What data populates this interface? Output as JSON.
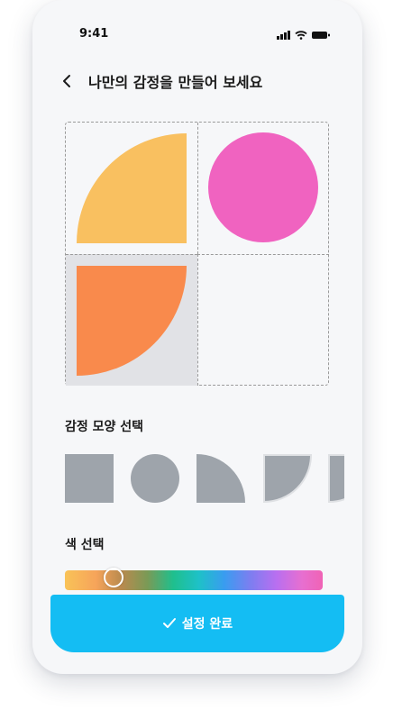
{
  "status": {
    "time": "9:41"
  },
  "header": {
    "title": "나만의 감정을 만들어 보세요",
    "back_icon": "chevron-left-icon"
  },
  "shape_section": {
    "label": "감정 모양 선택"
  },
  "color_section": {
    "label": "색 선택",
    "selected_position_pct": 19
  },
  "confirm": {
    "label": "설정 완료",
    "icon": "check-icon"
  },
  "colors": {
    "accent": "#14bdf3",
    "yellow": "#f9c060",
    "pink": "#f063c0",
    "orange": "#f98a4c",
    "shape_gray": "#9ea4ab"
  }
}
